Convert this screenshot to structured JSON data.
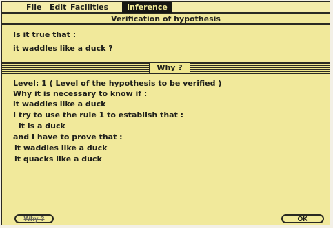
{
  "menu": {
    "apple": "",
    "file": "File",
    "edit": "Edit",
    "facilities": "Facilities",
    "inference": "Inference"
  },
  "dialog": {
    "title": "Verification of hypothesis",
    "question_prompt": "Is it true that :",
    "question": "it waddles like a duck ?",
    "why_panel_label": "Why ?",
    "content_lines": [
      "Level: 1  ( Level of the hypothesis to be verified )",
      "Why it is necessary to know if :",
      "it waddles like a duck",
      "I try to use the rule 1  to establish that  :",
      "it is a duck",
      "and I have to prove that :",
      "it waddles like a duck",
      "it quacks like a duck"
    ],
    "buttons": {
      "why": "Why ?",
      "ok": "OK"
    }
  },
  "colors": {
    "background": "#f1e99b",
    "ink": "#1e1f1a",
    "highlight": "#171713"
  },
  "icons": {
    "apple": "apple-icon"
  }
}
